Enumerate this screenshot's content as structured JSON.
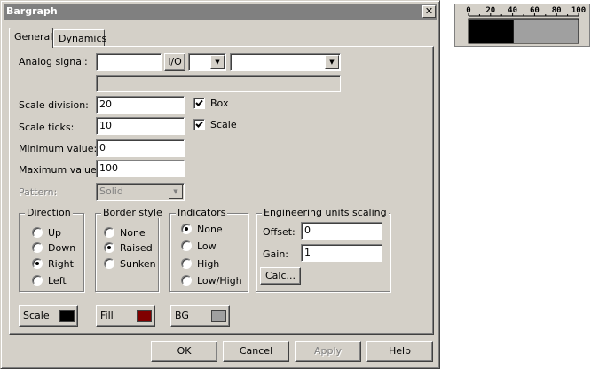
{
  "window": {
    "title": "Bargraph",
    "close_glyph": "✕"
  },
  "tabs": [
    {
      "label": "General",
      "active": true
    },
    {
      "label": "Dynamics",
      "active": false
    }
  ],
  "analog_signal": {
    "label": "Analog signal:",
    "value": "",
    "io_button": "I/O",
    "type_value": "",
    "tag_value": "",
    "description": ""
  },
  "scale_division": {
    "label": "Scale division:",
    "value": "20"
  },
  "scale_ticks": {
    "label": "Scale ticks:",
    "value": "10"
  },
  "minimum_value": {
    "label": "Minimum value:",
    "value": "0"
  },
  "maximum_value": {
    "label": "Maximum value:",
    "value": "100"
  },
  "pattern": {
    "label": "Pattern:",
    "value": "Solid"
  },
  "checkboxes": {
    "box": {
      "label": "Box",
      "checked": true
    },
    "scale": {
      "label": "Scale",
      "checked": true
    }
  },
  "direction": {
    "title": "Direction",
    "options": [
      "Up",
      "Down",
      "Right",
      "Left"
    ],
    "selected": "Right"
  },
  "border_style": {
    "title": "Border style",
    "options": [
      "None",
      "Raised",
      "Sunken"
    ],
    "selected": "Raised"
  },
  "indicators": {
    "title": "Indicators",
    "options": [
      "None",
      "Low",
      "High",
      "Low/High"
    ],
    "selected": "None"
  },
  "engineering": {
    "title": "Engineering units scaling",
    "offset_label": "Offset:",
    "offset_value": "0",
    "gain_label": "Gain:",
    "gain_value": "1",
    "calc_button": "Calc..."
  },
  "color_buttons": [
    {
      "label": "Scale",
      "color": "#000000"
    },
    {
      "label": "Fill",
      "color": "#800000"
    },
    {
      "label": "BG",
      "color": "#a0a0a0"
    }
  ],
  "footer": {
    "ok": "OK",
    "cancel": "Cancel",
    "apply": "Apply",
    "help": "Help"
  },
  "preview": {
    "scale_labels": [
      "0",
      "20",
      "40",
      "60",
      "80",
      "100"
    ],
    "fill_fraction": 0.4,
    "fill_color": "#000000",
    "bg_color": "#a0a0a0"
  }
}
